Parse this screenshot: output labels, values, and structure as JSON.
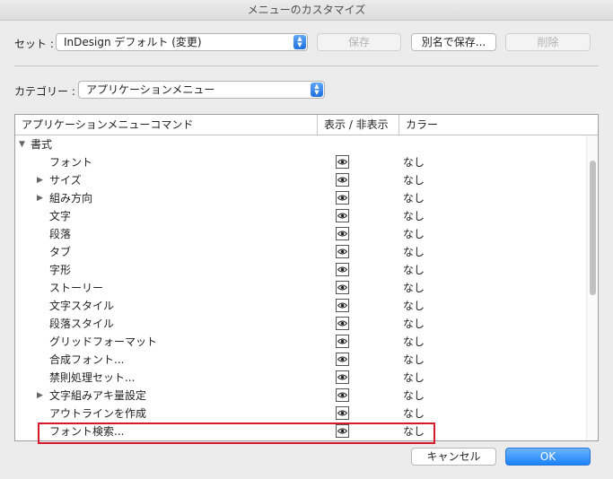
{
  "window": {
    "title": "メニューのカスタマイズ"
  },
  "set_row": {
    "label": "セット :",
    "selected": "InDesign デフォルト (変更)",
    "save_label": "保存",
    "save_as_label": "別名で保存...",
    "delete_label": "削除"
  },
  "category_row": {
    "label": "カテゴリー :",
    "selected": "アプリケーションメニュー"
  },
  "table": {
    "columns": [
      "アプリケーションメニューコマンド",
      "表示 / 非表示",
      "カラー"
    ],
    "group": {
      "label": "書式",
      "expanded": true
    },
    "rows": [
      {
        "label": "フォント",
        "submenu": false,
        "visible": true,
        "color": "なし"
      },
      {
        "label": "サイズ",
        "submenu": true,
        "visible": true,
        "color": "なし"
      },
      {
        "label": "組み方向",
        "submenu": true,
        "visible": true,
        "color": "なし"
      },
      {
        "label": "文字",
        "submenu": false,
        "visible": true,
        "color": "なし"
      },
      {
        "label": "段落",
        "submenu": false,
        "visible": true,
        "color": "なし"
      },
      {
        "label": "タブ",
        "submenu": false,
        "visible": true,
        "color": "なし"
      },
      {
        "label": "字形",
        "submenu": false,
        "visible": true,
        "color": "なし"
      },
      {
        "label": "ストーリー",
        "submenu": false,
        "visible": true,
        "color": "なし"
      },
      {
        "label": "文字スタイル",
        "submenu": false,
        "visible": true,
        "color": "なし"
      },
      {
        "label": "段落スタイル",
        "submenu": false,
        "visible": true,
        "color": "なし"
      },
      {
        "label": "グリッドフォーマット",
        "submenu": false,
        "visible": true,
        "color": "なし"
      },
      {
        "label": "合成フォント...",
        "submenu": false,
        "visible": true,
        "color": "なし"
      },
      {
        "label": "禁則処理セット...",
        "submenu": false,
        "visible": true,
        "color": "なし"
      },
      {
        "label": "文字組みアキ量設定",
        "submenu": true,
        "visible": true,
        "color": "なし"
      },
      {
        "label": "アウトラインを作成",
        "submenu": false,
        "visible": true,
        "color": "なし"
      },
      {
        "label": "フォント検索...",
        "submenu": false,
        "visible": true,
        "color": "なし"
      }
    ]
  },
  "footer": {
    "cancel_label": "キャンセル",
    "ok_label": "OK"
  },
  "colors": {
    "accent": "#1a82fb",
    "highlight": "#d6182a"
  }
}
